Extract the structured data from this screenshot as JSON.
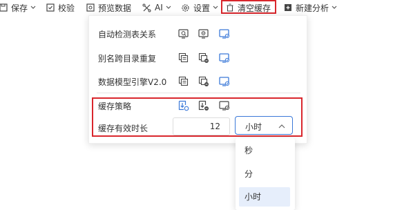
{
  "toolbar": {
    "save_label": "保存",
    "validate_label": "校验",
    "preview_label": "预览数据",
    "ai_label": "AI",
    "settings_label": "设置",
    "clear_cache_label": "清空缓存",
    "new_analysis_label": "新建分析"
  },
  "panel": {
    "rows": [
      {
        "label": "自动检测表关系",
        "icons": [
          "monitor-search-icon",
          "monitor-minus-icon",
          "monitor-active-icon"
        ]
      },
      {
        "label": "别名跨目录重复",
        "icons": [
          "copy-doc-icon",
          "copy-doc-minus-icon",
          "monitor-active-icon"
        ]
      },
      {
        "label": "数据模型引擎V2.0",
        "icons": [
          "copy-doc-icon",
          "copy-doc-minus-icon",
          "monitor-active-icon"
        ]
      }
    ],
    "cache_strategy": {
      "label": "缓存策略",
      "icons": [
        "download-refresh-icon",
        "download-minus-icon",
        "monitor-check-icon"
      ]
    },
    "cache_duration": {
      "label": "缓存有效时长",
      "value": "12",
      "unit_selected": "小时"
    }
  },
  "dropdown": {
    "options": [
      "秒",
      "分",
      "小时"
    ],
    "selected": "小时"
  },
  "colors": {
    "accent": "#3a78d8",
    "highlight_border": "#d9262c"
  }
}
